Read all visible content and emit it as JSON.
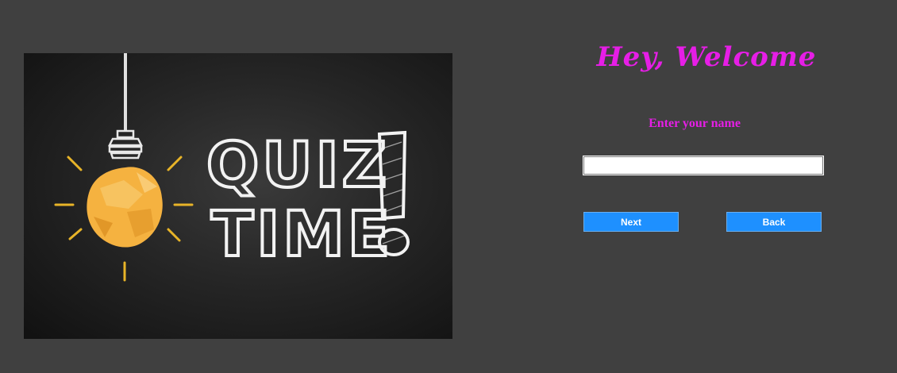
{
  "banner": {
    "line1": "QUIZ",
    "line2": "TIME",
    "exclaim": "!"
  },
  "header": {
    "title": "Hey, Welcome"
  },
  "form": {
    "name_label": "Enter your name",
    "name_value": "",
    "next_label": "Next",
    "back_label": "Back"
  },
  "colors": {
    "background": "#404040",
    "title": "#e61ee6",
    "button": "#1e90ff",
    "bulb": "#f5b240"
  }
}
